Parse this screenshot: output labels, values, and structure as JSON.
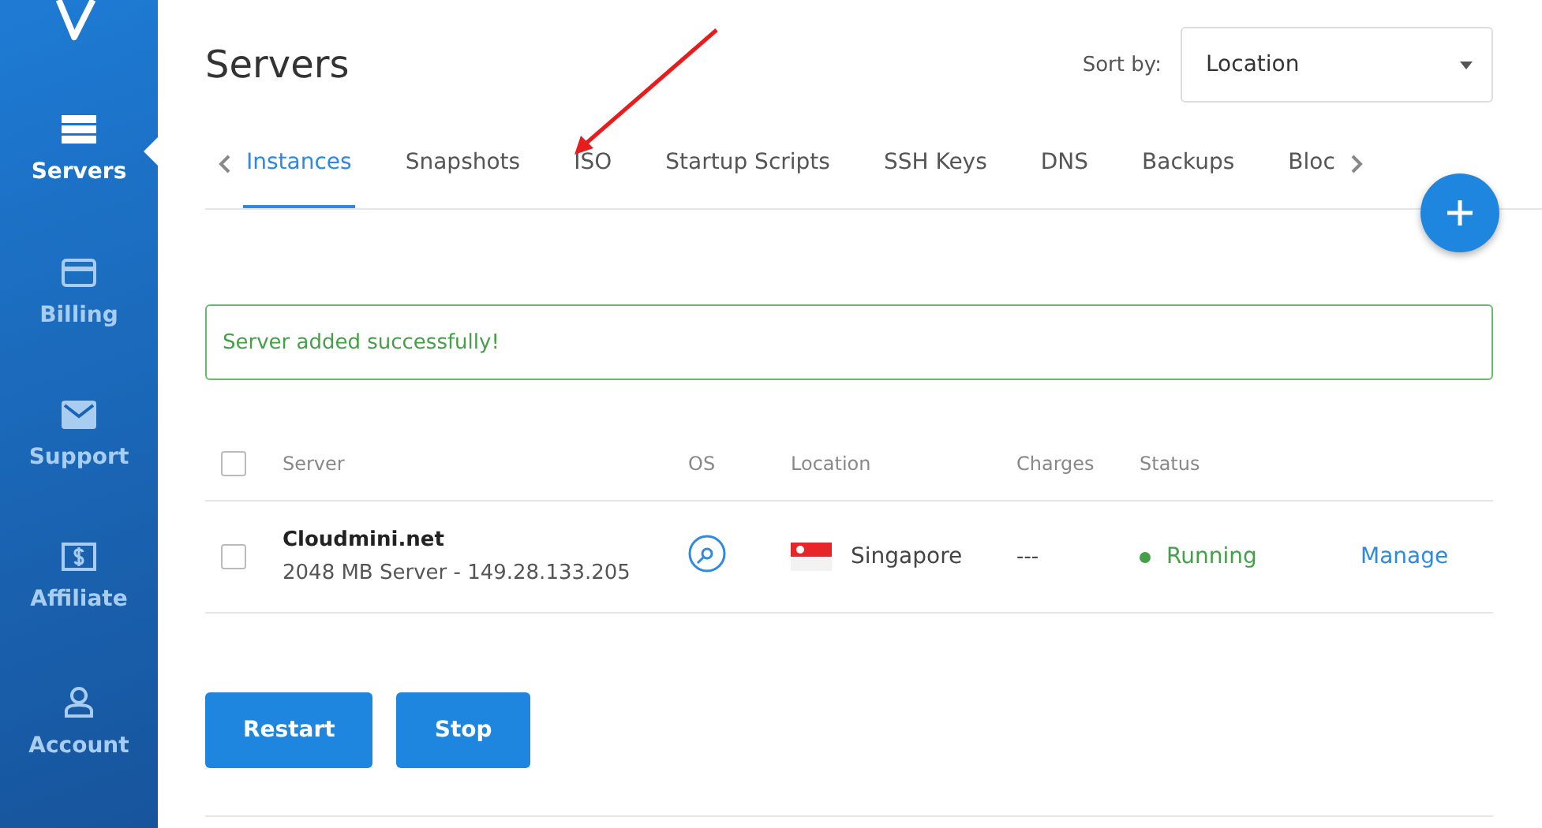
{
  "sidebar": {
    "items": [
      {
        "label": "Servers",
        "selected": true
      },
      {
        "label": "Billing",
        "selected": false
      },
      {
        "label": "Support",
        "selected": false
      },
      {
        "label": "Affiliate",
        "selected": false
      },
      {
        "label": "Account",
        "selected": false
      }
    ]
  },
  "page_title": "Servers",
  "sort": {
    "label": "Sort by:",
    "value": "Location"
  },
  "tabs": [
    {
      "label": "Instances",
      "selected": true
    },
    {
      "label": "Snapshots",
      "selected": false
    },
    {
      "label": "ISO",
      "selected": false
    },
    {
      "label": "Startup Scripts",
      "selected": false
    },
    {
      "label": "SSH Keys",
      "selected": false
    },
    {
      "label": "DNS",
      "selected": false
    },
    {
      "label": "Backups",
      "selected": false
    },
    {
      "label": "Bloc",
      "selected": false
    }
  ],
  "alert": "Server added successfully!",
  "table": {
    "all_checked": false,
    "columns": [
      "Server",
      "OS",
      "Location",
      "Charges",
      "Status"
    ],
    "rows": [
      {
        "checked": false,
        "name": "Cloudmini.net",
        "detail": "2048 MB Server - 149.28.133.205",
        "location": "Singapore",
        "charges": "---",
        "status": "Running",
        "color": "#43a047",
        "action": "Manage"
      }
    ]
  },
  "buttons": [
    "Restart",
    "Stop"
  ]
}
